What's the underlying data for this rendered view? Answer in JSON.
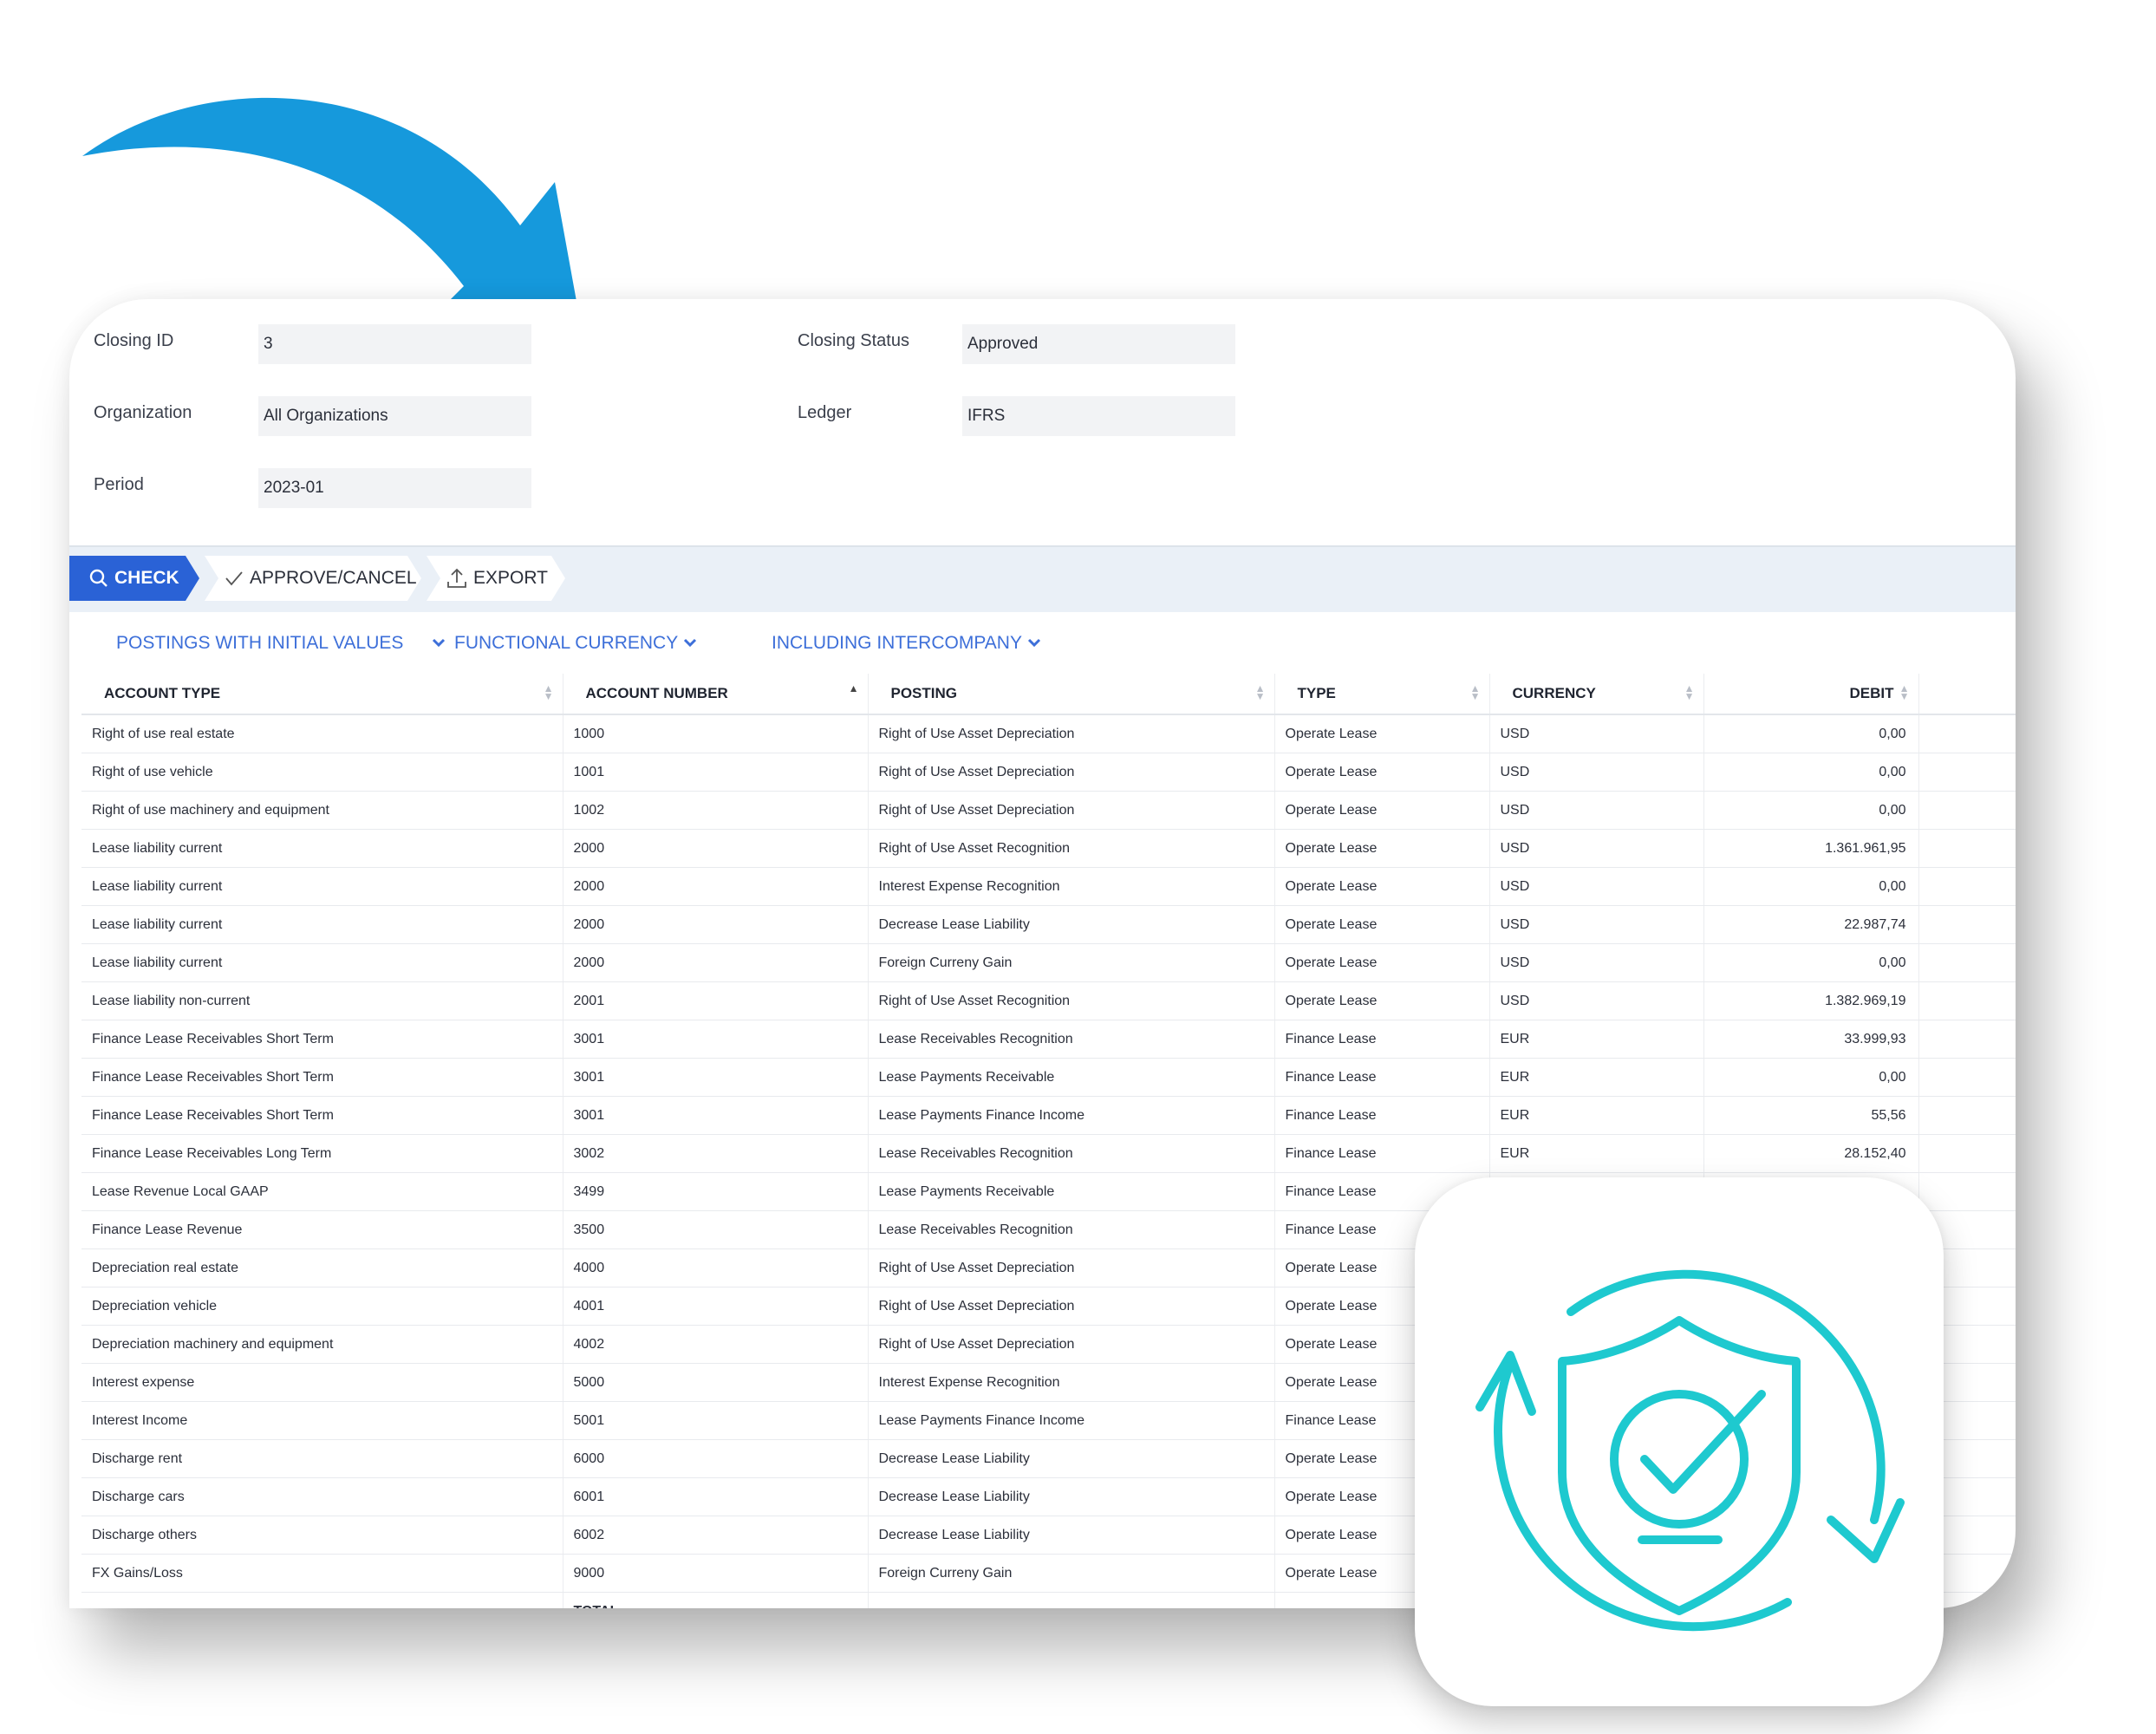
{
  "colors": {
    "accent": "#2a62d6",
    "filter_link": "#3d6fd9",
    "arrow": "#1699dc",
    "badge_icon": "#1ec9cf"
  },
  "header": {
    "closing_id": {
      "label": "Closing ID",
      "value": "3"
    },
    "organization": {
      "label": "Organization",
      "value": "All Organizations"
    },
    "period": {
      "label": "Period",
      "value": "2023-01"
    },
    "closing_status": {
      "label": "Closing Status",
      "value": "Approved"
    },
    "ledger": {
      "label": "Ledger",
      "value": "IFRS"
    }
  },
  "toolbar": {
    "check": {
      "label": "CHECK",
      "icon": "search-icon"
    },
    "approve": {
      "label": "APPROVE/CANCEL",
      "icon": "checkmark-icon"
    },
    "export": {
      "label": "EXPORT",
      "icon": "upload-icon"
    }
  },
  "filters": {
    "postings": "POSTINGS WITH INITIAL VALUES",
    "currency": "FUNCTIONAL CURRENCY",
    "intercompany": "INCLUDING INTERCOMPANY"
  },
  "table": {
    "columns": [
      "ACCOUNT TYPE",
      "ACCOUNT NUMBER",
      "POSTING",
      "TYPE",
      "CURRENCY",
      "DEBIT"
    ],
    "rows": [
      [
        "Right of use real estate",
        "1000",
        "Right of Use Asset Depreciation",
        "Operate Lease",
        "USD",
        "0,00"
      ],
      [
        "Right of use vehicle",
        "1001",
        "Right of Use Asset Depreciation",
        "Operate Lease",
        "USD",
        "0,00"
      ],
      [
        "Right of use machinery and equipment",
        "1002",
        "Right of Use Asset Depreciation",
        "Operate Lease",
        "USD",
        "0,00"
      ],
      [
        "Lease liability current",
        "2000",
        "Right of Use Asset Recognition",
        "Operate Lease",
        "USD",
        "1.361.961,95"
      ],
      [
        "Lease liability current",
        "2000",
        "Interest Expense Recognition",
        "Operate Lease",
        "USD",
        "0,00"
      ],
      [
        "Lease liability current",
        "2000",
        "Decrease Lease Liability",
        "Operate Lease",
        "USD",
        "22.987,74"
      ],
      [
        "Lease liability current",
        "2000",
        "Foreign Curreny Gain",
        "Operate Lease",
        "USD",
        "0,00"
      ],
      [
        "Lease liability non-current",
        "2001",
        "Right of Use Asset Recognition",
        "Operate Lease",
        "USD",
        "1.382.969,19"
      ],
      [
        "Finance Lease Receivables Short Term",
        "3001",
        "Lease Receivables Recognition",
        "Finance Lease",
        "EUR",
        "33.999,93"
      ],
      [
        "Finance Lease Receivables Short Term",
        "3001",
        "Lease Payments Receivable",
        "Finance Lease",
        "EUR",
        "0,00"
      ],
      [
        "Finance Lease Receivables Short Term",
        "3001",
        "Lease Payments Finance Income",
        "Finance Lease",
        "EUR",
        "55,56"
      ],
      [
        "Finance Lease Receivables Long Term",
        "3002",
        "Lease Receivables Recognition",
        "Finance Lease",
        "EUR",
        "28.152,40"
      ],
      [
        "Lease Revenue Local GAAP",
        "3499",
        "Lease Payments Receivable",
        "Finance Lease",
        "",
        ""
      ],
      [
        "Finance Lease Revenue",
        "3500",
        "Lease Receivables Recognition",
        "Finance Lease",
        "",
        ""
      ],
      [
        "Depreciation real estate",
        "4000",
        "Right of Use Asset Depreciation",
        "Operate Lease",
        "",
        ""
      ],
      [
        "Depreciation vehicle",
        "4001",
        "Right of Use Asset Depreciation",
        "Operate Lease",
        "",
        ""
      ],
      [
        "Depreciation machinery and equipment",
        "4002",
        "Right of Use Asset Depreciation",
        "Operate Lease",
        "",
        ""
      ],
      [
        "Interest expense",
        "5000",
        "Interest Expense Recognition",
        "Operate Lease",
        "",
        ""
      ],
      [
        "Interest Income",
        "5001",
        "Lease Payments Finance Income",
        "Finance Lease",
        "",
        ""
      ],
      [
        "Discharge rent",
        "6000",
        "Decrease Lease Liability",
        "Operate Lease",
        "",
        ""
      ],
      [
        "Discharge cars",
        "6001",
        "Decrease Lease Liability",
        "Operate Lease",
        "",
        ""
      ],
      [
        "Discharge others",
        "6002",
        "Decrease Lease Liability",
        "Operate Lease",
        "",
        ""
      ],
      [
        "FX Gains/Loss",
        "9000",
        "Foreign Curreny Gain",
        "Operate Lease",
        "",
        ""
      ]
    ],
    "total_label": "TOTAL:"
  },
  "decorations": {
    "arrow": "curved-arrow-icon",
    "badge": "shield-check-sync-icon"
  }
}
